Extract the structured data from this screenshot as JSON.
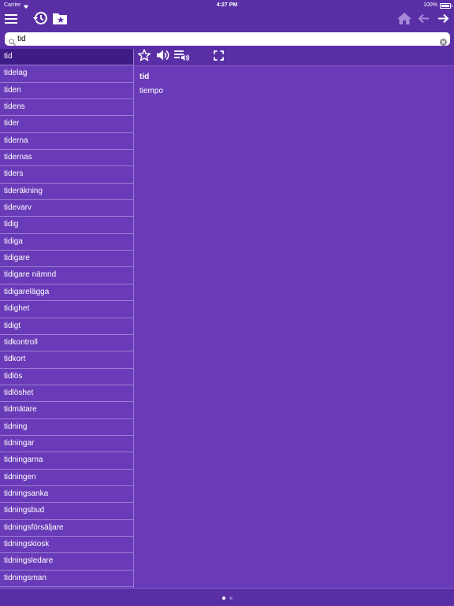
{
  "status_bar": {
    "carrier": "Carrier",
    "time": "4:27 PM",
    "battery": "100%"
  },
  "toolbar": {
    "menu_icon": "hamburger-icon",
    "history_icon": "history-icon",
    "favorites_icon": "star-folder-icon",
    "home_icon": "home-icon",
    "back_icon": "arrow-left-icon",
    "forward_icon": "arrow-right-icon"
  },
  "search": {
    "value": "tid"
  },
  "word_list": {
    "selected_index": 0,
    "items": [
      "tid",
      "tidelag",
      "tiden",
      "tidens",
      "tider",
      "tiderna",
      "tidernas",
      "tiders",
      "tideräkning",
      "tidevarv",
      "tidig",
      "tidiga",
      "tidigare",
      "tidigare nämnd",
      "tidigarelägga",
      "tidighet",
      "tidigt",
      "tidkontroll",
      "tidkort",
      "tidlös",
      "tidlöshet",
      "tidmätare",
      "tidning",
      "tidningar",
      "tidningarna",
      "tidningen",
      "tidningsanka",
      "tidningsbud",
      "tidningsförsäljare",
      "tidningskiosk",
      "tidningsledare",
      "tidningsman"
    ]
  },
  "entry": {
    "headword": "tid",
    "translation": "tiempo"
  },
  "page_indicator": {
    "pages": 2,
    "current": 1
  },
  "colors": {
    "background": "#6a3bb8",
    "bar": "#5a2fa6",
    "selected": "#3e1c86",
    "separator": "#9a7fd4"
  }
}
